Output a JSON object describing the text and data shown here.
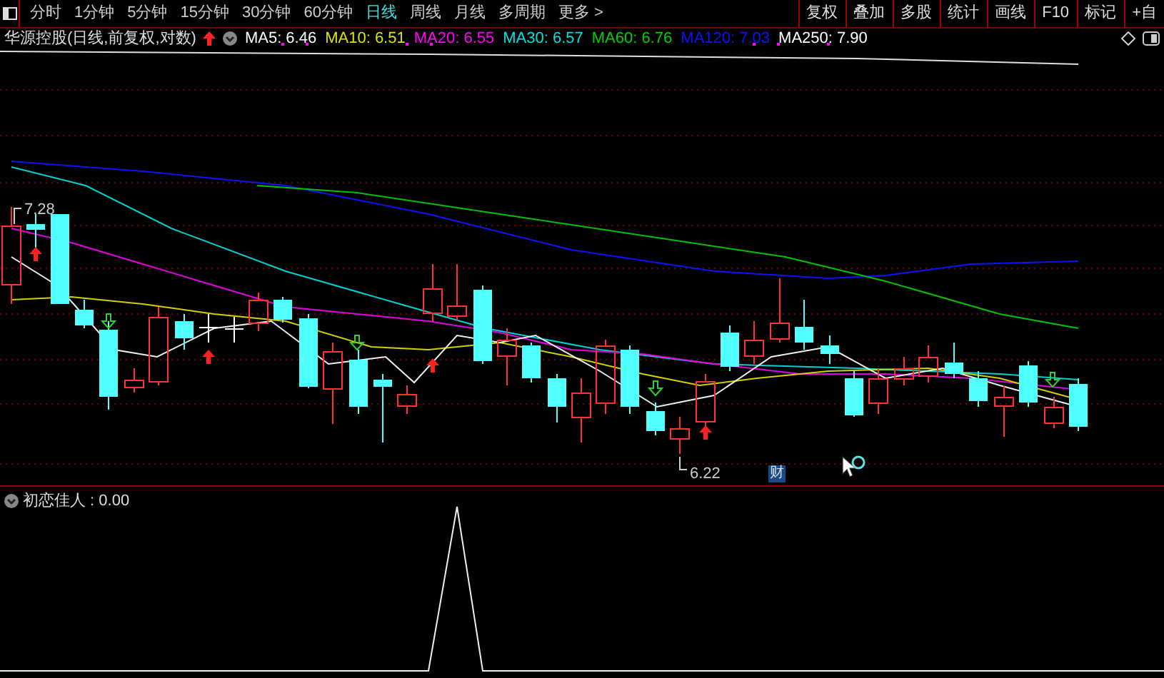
{
  "timeframe_tabs": [
    {
      "label": "分时",
      "selected": false
    },
    {
      "label": "1分钟",
      "selected": false
    },
    {
      "label": "5分钟",
      "selected": false
    },
    {
      "label": "15分钟",
      "selected": false
    },
    {
      "label": "30分钟",
      "selected": false
    },
    {
      "label": "60分钟",
      "selected": false
    },
    {
      "label": "日线",
      "selected": true
    },
    {
      "label": "周线",
      "selected": false
    },
    {
      "label": "月线",
      "selected": false
    },
    {
      "label": "多周期",
      "selected": false
    },
    {
      "label": "更多 >",
      "selected": false
    }
  ],
  "toolbar_buttons": [
    "复权",
    "叠加",
    "多股",
    "统计",
    "画线",
    "F10",
    "标记",
    "+自"
  ],
  "chart_title": "华源控股(日线,前复权,对数)",
  "ma_indicators": [
    {
      "label": "MA5: 6.46",
      "color": "#ffffff"
    },
    {
      "label": "MA10: 6.51",
      "color": "#e0e000"
    },
    {
      "label": "MA20: 6.55",
      "color": "#ff00ff"
    },
    {
      "label": "MA30: 6.57",
      "color": "#00e0e0"
    },
    {
      "label": "MA60: 6.76",
      "color": "#00d000"
    },
    {
      "label": "MA120: 7.03",
      "color": "#1010ff"
    },
    {
      "label": "MA250: 7.90",
      "color": "#ffffff"
    }
  ],
  "high_label": "7.28",
  "low_label": "6.22",
  "event_marker": "财",
  "indicator_panel": {
    "label": "初恋佳人 : 0.00"
  }
}
